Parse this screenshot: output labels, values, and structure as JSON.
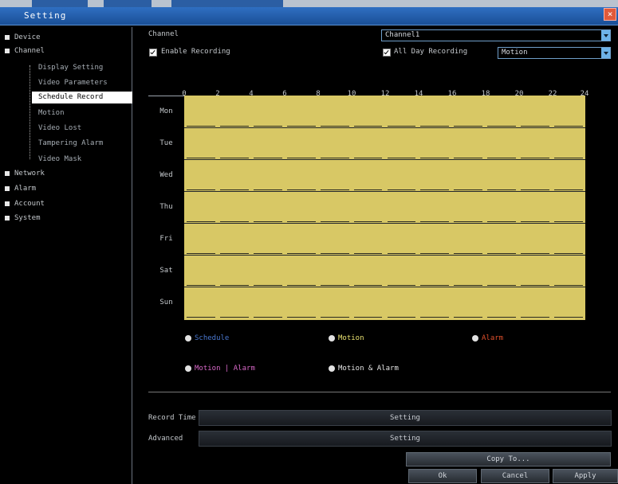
{
  "window": {
    "title": "Setting",
    "close_glyph": "×"
  },
  "sidebar": {
    "top_items": [
      {
        "label": "Device"
      },
      {
        "label": "Channel"
      }
    ],
    "channel_sub": [
      {
        "label": "Display Setting"
      },
      {
        "label": "Video Parameters"
      },
      {
        "label": "Schedule Record",
        "selected": true
      },
      {
        "label": "Motion"
      },
      {
        "label": "Video Lost"
      },
      {
        "label": "Tampering Alarm"
      },
      {
        "label": "Video Mask"
      }
    ],
    "bottom_items": [
      {
        "label": "Network"
      },
      {
        "label": "Alarm"
      },
      {
        "label": "Account"
      },
      {
        "label": "System"
      }
    ]
  },
  "main": {
    "channel_label": "Channel",
    "channel_value": "Channel1",
    "enable_recording_label": "Enable Recording",
    "allday_label": "All Day Recording",
    "allday_value": "Motion",
    "hours": [
      "0",
      "2",
      "4",
      "6",
      "8",
      "10",
      "12",
      "14",
      "16",
      "18",
      "20",
      "22",
      "24"
    ],
    "days": [
      "Mon",
      "Tue",
      "Wed",
      "Thu",
      "Fri",
      "Sat",
      "Sun"
    ],
    "legend": [
      {
        "label": "Schedule",
        "color": "#4a78d0"
      },
      {
        "label": "Motion",
        "color": "#e8e070"
      },
      {
        "label": "Alarm",
        "color": "#e0502c"
      },
      {
        "label": "Motion | Alarm",
        "color": "#d868c8"
      },
      {
        "label": "Motion & Alarm",
        "color": "#e4e4e4"
      }
    ],
    "record_time_label": "Record Time",
    "record_time_button": "Setting",
    "advanced_label": "Advanced",
    "advanced_button": "Setting",
    "copy_button": "Copy To...",
    "ok_button": "Ok",
    "cancel_button": "Cancel",
    "apply_button": "Apply"
  },
  "colors": {
    "schedule_fill": "#d8c865",
    "accent": "#2f6fc2"
  }
}
